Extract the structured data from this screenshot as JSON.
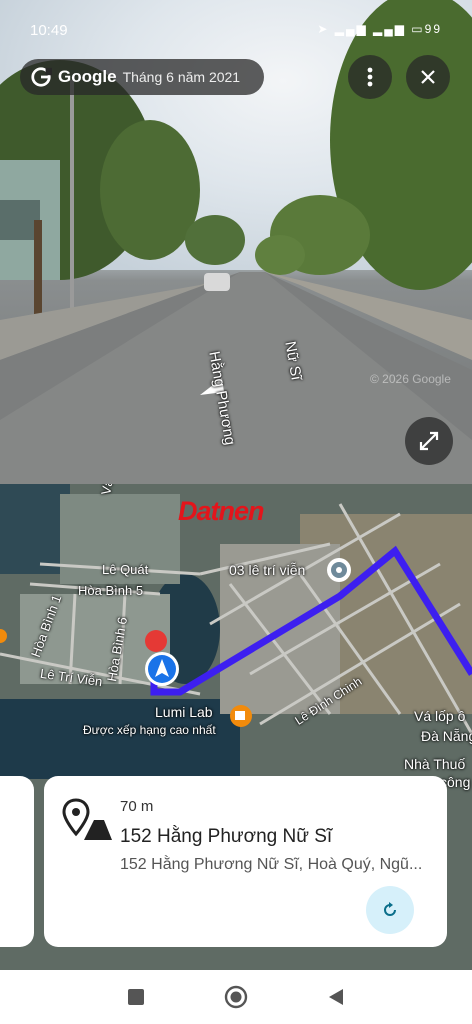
{
  "status": {
    "time": "10:49",
    "battery": "99"
  },
  "streetview": {
    "brand": "Google",
    "date": "Tháng 6 năm 2021",
    "road_label_1": "Hằng Phương",
    "road_label_2": "Nữ Sĩ",
    "watermark": "© 2026 Google"
  },
  "map": {
    "brand": "Datnen",
    "labels": {
      "van_don": "Vân Đồn",
      "le_quat": "Lê Quát",
      "hoa_binh_5": "Hòa Bình 5",
      "hoa_binh_1": "Hòa Bình 1",
      "hoa_binh_6": "Hòa Bình 6",
      "le_tri_vien": "Lê Trí Viễn",
      "dest": "03 lê trí viễn",
      "le_dinh_chinh": "Lê Đình Chinh",
      "lumi_lab": "Lumi Lab",
      "rated": "Được xếp hạng cao nhất",
      "va_lop": "Vá lốp ô",
      "da_nang": "Đà Nẵng T",
      "nha_thuoc": "Nhà Thuố",
      "cong": "công"
    }
  },
  "card": {
    "distance": "70 m",
    "title": "152 Hằng Phương Nữ Sĩ",
    "address": "152 Hằng Phương Nữ Sĩ, Hoà Quý, Ngũ..."
  }
}
